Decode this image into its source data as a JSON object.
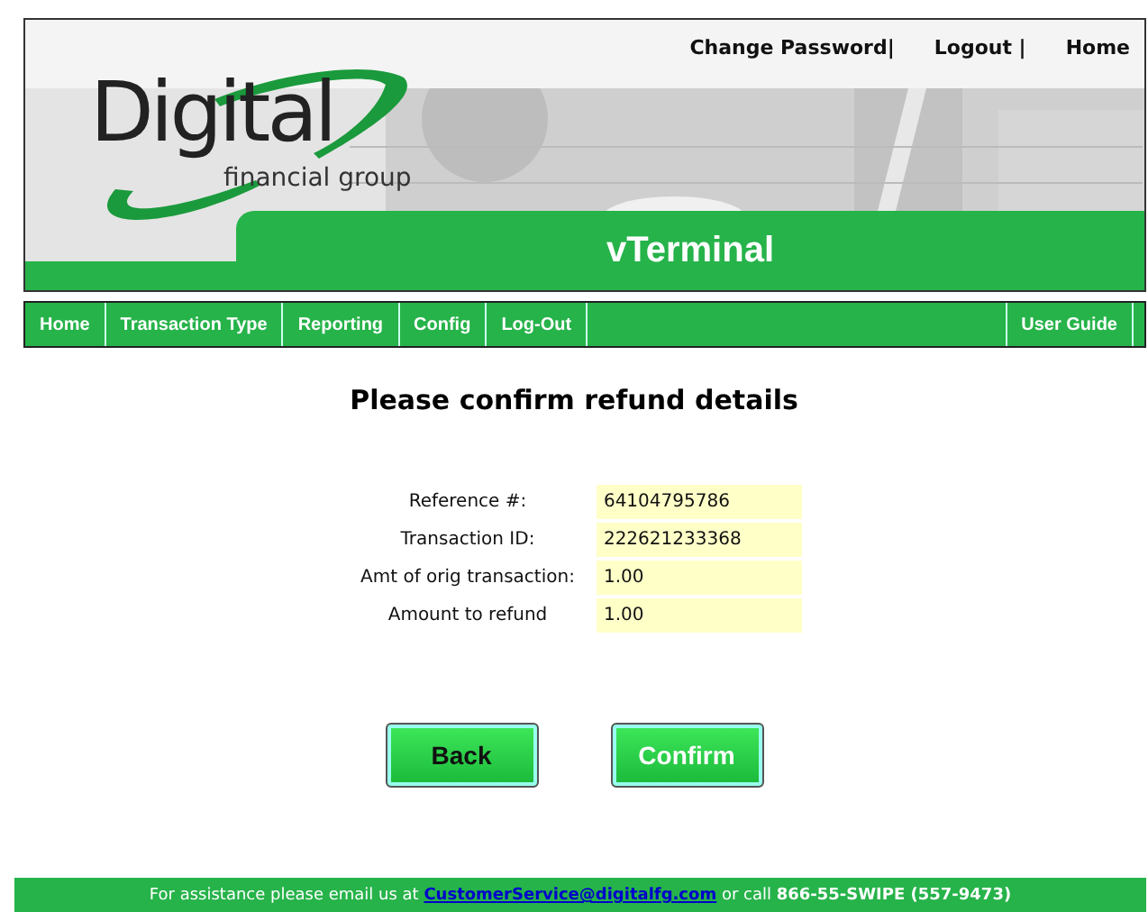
{
  "header": {
    "links": [
      "Change Password|",
      "Logout |",
      "Home"
    ],
    "logo": {
      "name": "Digital",
      "tagline": "financial group"
    },
    "banner_title": "vTerminal"
  },
  "nav": {
    "items": [
      "Home",
      "Transaction Type",
      "Reporting",
      "Config",
      "Log-Out"
    ],
    "right_items": [
      "User Guide"
    ]
  },
  "heading": "Please confirm refund details",
  "details": [
    {
      "label": "Reference #:",
      "value": "64104795786"
    },
    {
      "label": "Transaction ID:",
      "value": "222621233368"
    },
    {
      "label": "Amt of orig transaction:",
      "value": "1.00"
    },
    {
      "label": "Amount to refund",
      "value": "1.00"
    }
  ],
  "buttons": [
    "Back",
    "Confirm"
  ],
  "footer": {
    "before": "For assistance please email us at ",
    "link": "CustomerService@digitalfg.com",
    "after": " or call **866-55-SWIPE (557-9473)**"
  }
}
